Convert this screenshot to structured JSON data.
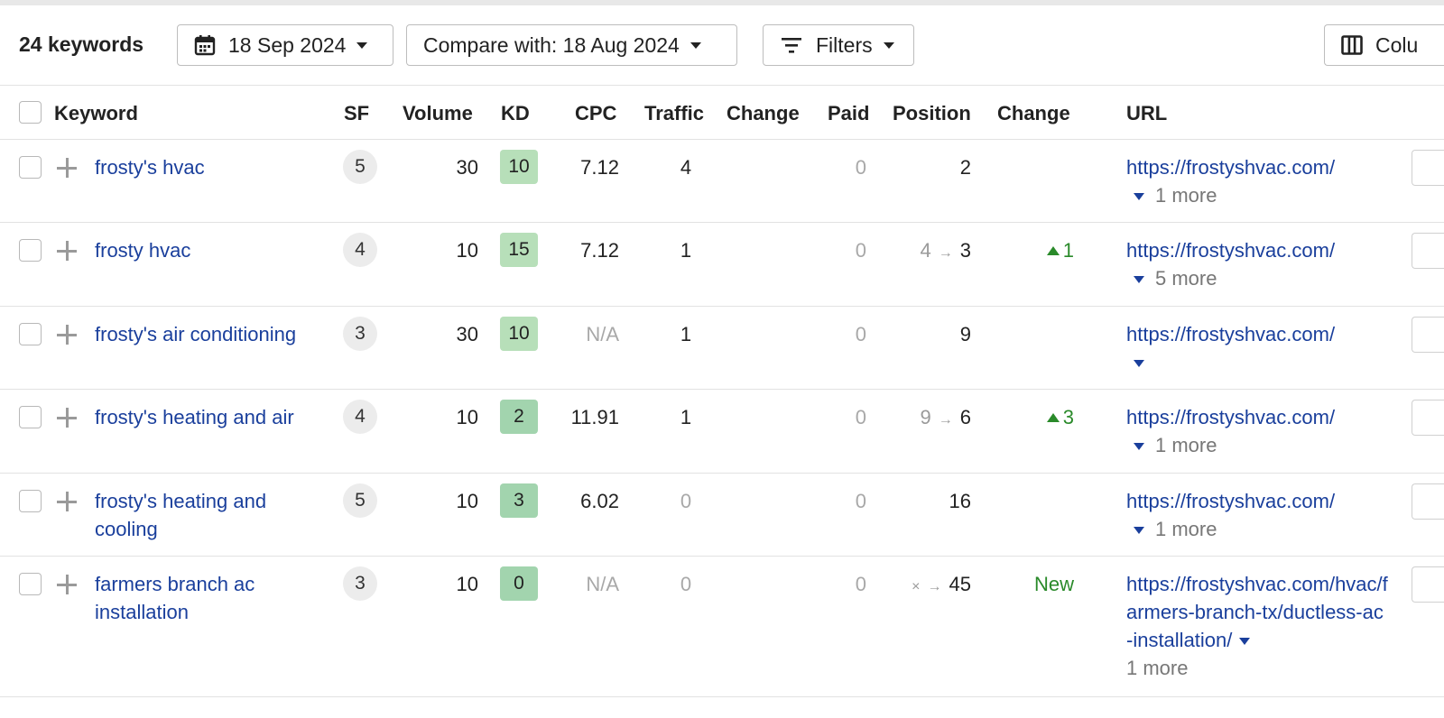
{
  "toolbar": {
    "keyword_count": "24 keywords",
    "date": "18 Sep 2024",
    "compare": "Compare with: 18 Aug 2024",
    "filters": "Filters",
    "columns": "Colu"
  },
  "headers": {
    "keyword": "Keyword",
    "sf": "SF",
    "volume": "Volume",
    "kd": "KD",
    "cpc": "CPC",
    "traffic": "Traffic",
    "change": "Change",
    "paid": "Paid",
    "position": "Position",
    "position_change": "Change",
    "url": "URL"
  },
  "rows": [
    {
      "keyword": "frosty's hvac",
      "sf": "5",
      "volume": "30",
      "kd": "10",
      "cpc": "7.12",
      "traffic": "4",
      "paid": "0",
      "pos_from": "",
      "position": "2",
      "change": "",
      "url": "https://frostyshvac.com/",
      "more": "1 more"
    },
    {
      "keyword": "frosty hvac",
      "sf": "4",
      "volume": "10",
      "kd": "15",
      "cpc": "7.12",
      "traffic": "1",
      "paid": "0",
      "pos_from": "4",
      "position": "3",
      "change": "1",
      "url": "https://frostyshvac.com/",
      "more": "5 more"
    },
    {
      "keyword": "frosty's air conditioning",
      "sf": "3",
      "volume": "30",
      "kd": "10",
      "cpc": "N/A",
      "traffic": "1",
      "paid": "0",
      "pos_from": "",
      "position": "9",
      "change": "",
      "url": "https://frostyshvac.com/",
      "more": ""
    },
    {
      "keyword": "frosty's heating and air",
      "sf": "4",
      "volume": "10",
      "kd": "2",
      "cpc": "11.91",
      "traffic": "1",
      "paid": "0",
      "pos_from": "9",
      "position": "6",
      "change": "3",
      "url": "https://frostyshvac.com/",
      "more": "1 more"
    },
    {
      "keyword": "frosty's heating and cooling",
      "sf": "5",
      "volume": "10",
      "kd": "3",
      "cpc": "6.02",
      "traffic": "0",
      "paid": "0",
      "pos_from": "",
      "position": "16",
      "change": "",
      "url": "https://frostyshvac.com/",
      "more": "1 more"
    },
    {
      "keyword": "farmers branch ac installation",
      "sf": "3",
      "volume": "10",
      "kd": "0",
      "cpc": "N/A",
      "traffic": "0",
      "paid": "0",
      "pos_from": "×",
      "position": "45",
      "change": "New",
      "url": "https://frostyshvac.com/hvac/farmers-branch-tx/ductless-ac-installation/",
      "more": "1 more"
    }
  ],
  "colors": {
    "link": "#1a3f9c",
    "positive": "#2a8a2a",
    "kd_light": "#b7dfb9",
    "kd_medium": "#a2d4ae"
  }
}
